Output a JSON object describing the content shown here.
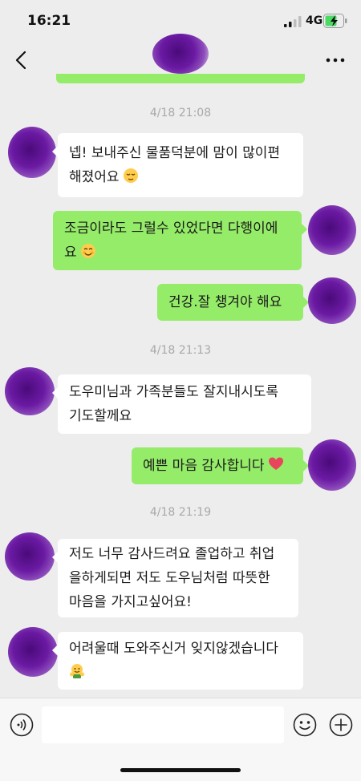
{
  "status_bar": {
    "time": "16:21",
    "network": "4G"
  },
  "chat": {
    "messages": [
      {
        "type": "timestamp",
        "text": "4/18 21:08"
      },
      {
        "type": "incoming",
        "lines": [
          "넵! 보내주신 물품덕분에 맘이 많이편",
          "해졌어요"
        ],
        "emoji": "relieved-face-emoji"
      },
      {
        "type": "outgoing",
        "lines": [
          "조금이라도 그럴수 있었다면 다행이에",
          "요"
        ],
        "emoji": "smiling-face-emoji"
      },
      {
        "type": "outgoing",
        "lines": [
          "건강.잘 챙겨야 해요"
        ]
      },
      {
        "type": "timestamp",
        "text": "4/18 21:13"
      },
      {
        "type": "incoming",
        "lines": [
          "도우미님과 가족분들도 잘지내시도록",
          "기도할께요"
        ]
      },
      {
        "type": "outgoing",
        "lines": [
          "예쁜 마음 감사합니다"
        ],
        "emoji": "heart-emoji"
      },
      {
        "type": "timestamp",
        "text": "4/18 21:19"
      },
      {
        "type": "incoming",
        "lines": [
          "저도 너무 감사드려요 졸업하고 취업",
          "을하게되면 저도 도우님처럼 따뜻한",
          "마음을 가지고싶어요!"
        ]
      },
      {
        "type": "incoming",
        "lines": [
          "어려울때 도와주신거 잊지않겠습니다"
        ],
        "emoji": "hugging-face-emoji"
      }
    ]
  },
  "input_bar": {
    "value": "",
    "placeholder": ""
  },
  "colors": {
    "outgoing_bubble": "#95ec69",
    "incoming_bubble": "#ffffff",
    "background": "#ededed",
    "redaction": "#6b1aa3"
  }
}
